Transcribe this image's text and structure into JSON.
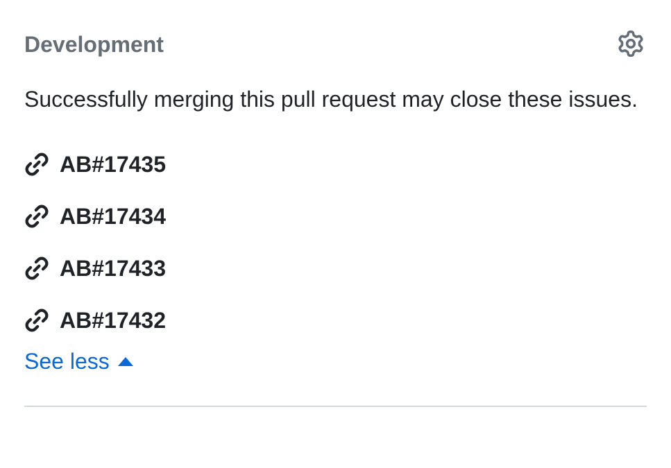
{
  "development": {
    "title": "Development",
    "description": "Successfully merging this pull request may close these issues.",
    "issues": [
      {
        "label": "AB#17435"
      },
      {
        "label": "AB#17434"
      },
      {
        "label": "AB#17433"
      },
      {
        "label": "AB#17432"
      }
    ],
    "toggle_label": "See less"
  }
}
